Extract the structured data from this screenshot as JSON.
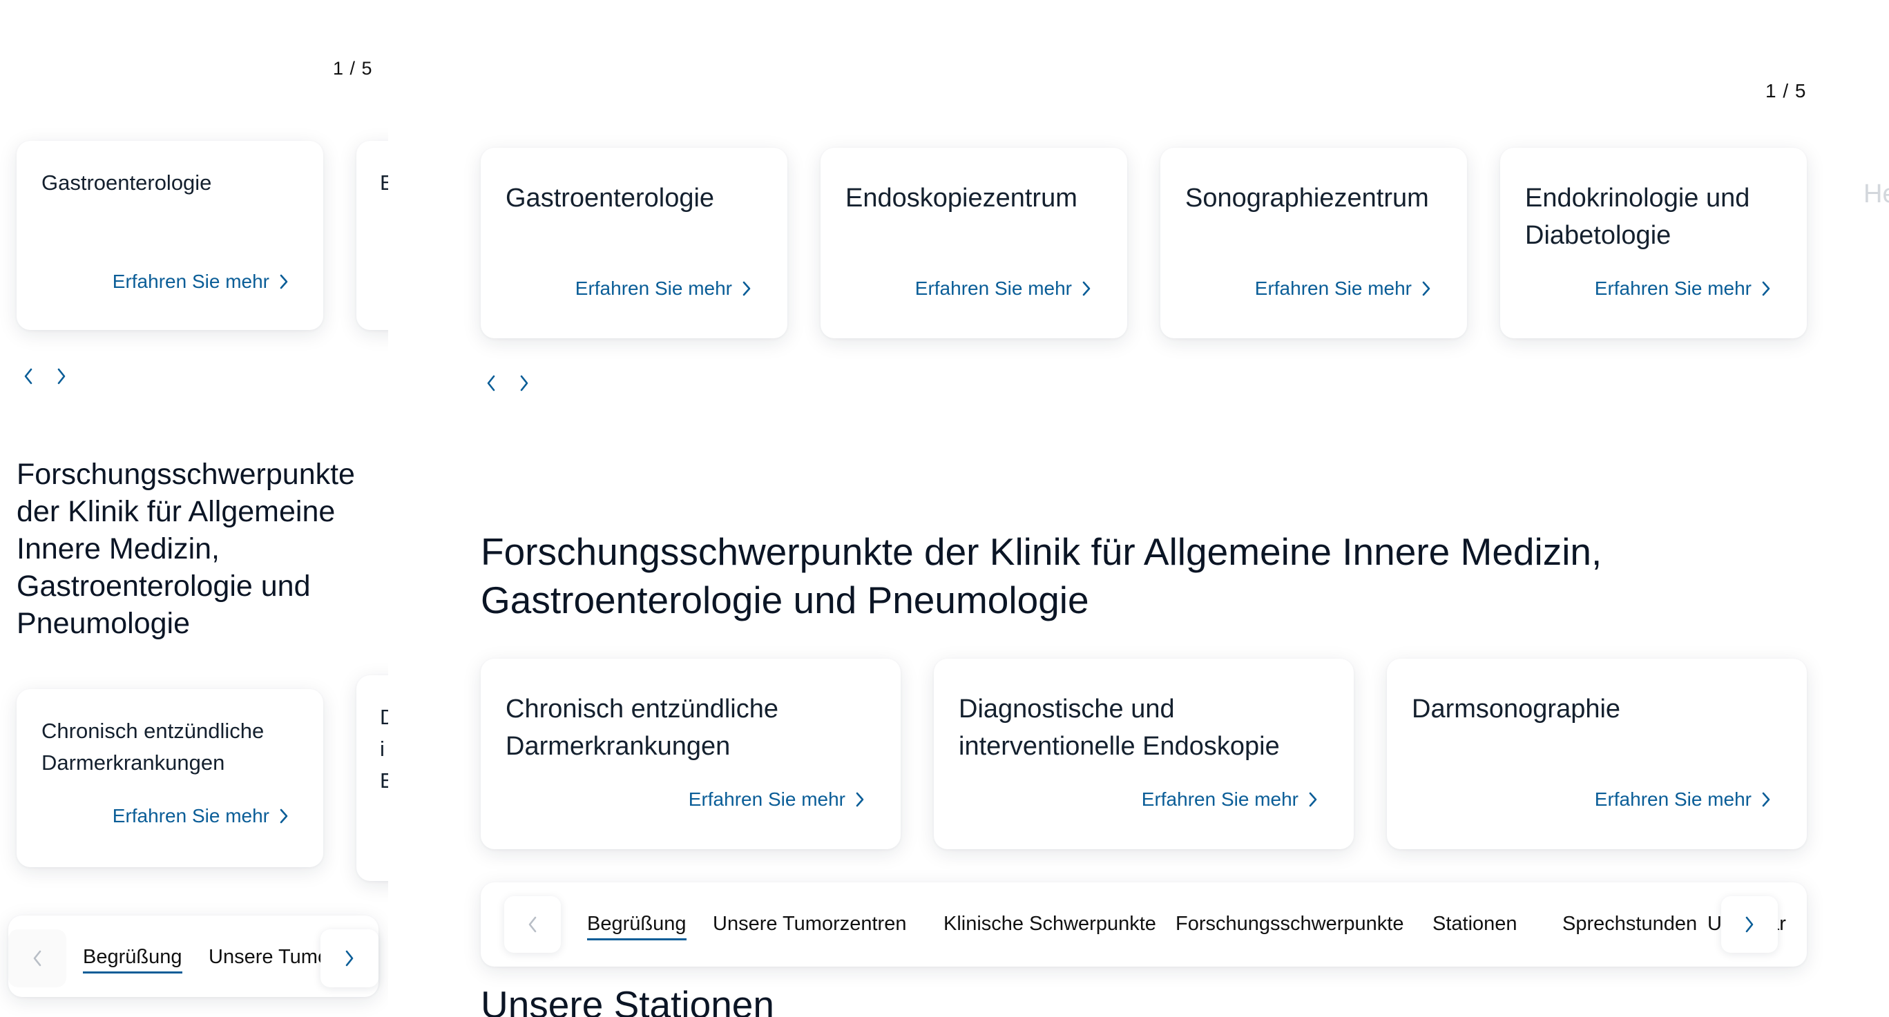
{
  "mobile": {
    "counter": "1 / 5",
    "carousel1": {
      "cards": [
        {
          "title": "Gastroenterologie",
          "link": "Erfahren Sie mehr"
        },
        {
          "title": "E",
          "link": ""
        }
      ]
    },
    "heading": "Forschungsschwerpunkte der Klinik für Allgemeine Innere Medizin, Gastroenterologie und Pneumologie",
    "carousel2": {
      "cards": [
        {
          "title": "Chronisch entzündliche Darmerkrankungen",
          "link": "Erfahren Sie mehr"
        },
        {
          "title_lines": [
            "D",
            "i",
            "E"
          ]
        }
      ]
    },
    "tabs": [
      "Begrüßung",
      "Unsere Tumc"
    ]
  },
  "desktop": {
    "counter": "1 / 5",
    "carousel1": {
      "cards": [
        {
          "title": "Gastroenterologie",
          "link": "Erfahren Sie mehr"
        },
        {
          "title": "Endoskopiezentrum",
          "link": "Erfahren Sie mehr"
        },
        {
          "title": "Sonographiezentrum",
          "link": "Erfahren Sie mehr"
        },
        {
          "title": "Endokrinologie und Diabetologie",
          "link": "Erfahren Sie mehr"
        }
      ],
      "peek": "He"
    },
    "heading": "Forschungsschwerpunkte der Klinik für Allgemeine Innere Medizin, Gastroenterologie und Pneumologie",
    "carousel2": {
      "cards": [
        {
          "title": "Chronisch entzündliche Darmerkrankungen",
          "link": "Erfahren Sie mehr"
        },
        {
          "title": "Diagnostische und interventionelle Endoskopie",
          "link": "Erfahren Sie mehr"
        },
        {
          "title": "Darmsonographie",
          "link": "Erfahren Sie mehr"
        }
      ]
    },
    "tabs": [
      "Begrüßung",
      "Unsere Tumorzentren",
      "Klinische Schwerpunkte",
      "Forschungsschwerpunkte",
      "Stationen",
      "Sprechstunden",
      "U",
      "ear"
    ],
    "next_heading": "Unsere Stationen"
  },
  "colors": {
    "link": "#0a5d97",
    "text": "#0e1a2b",
    "disabled": "#b8bec6"
  }
}
